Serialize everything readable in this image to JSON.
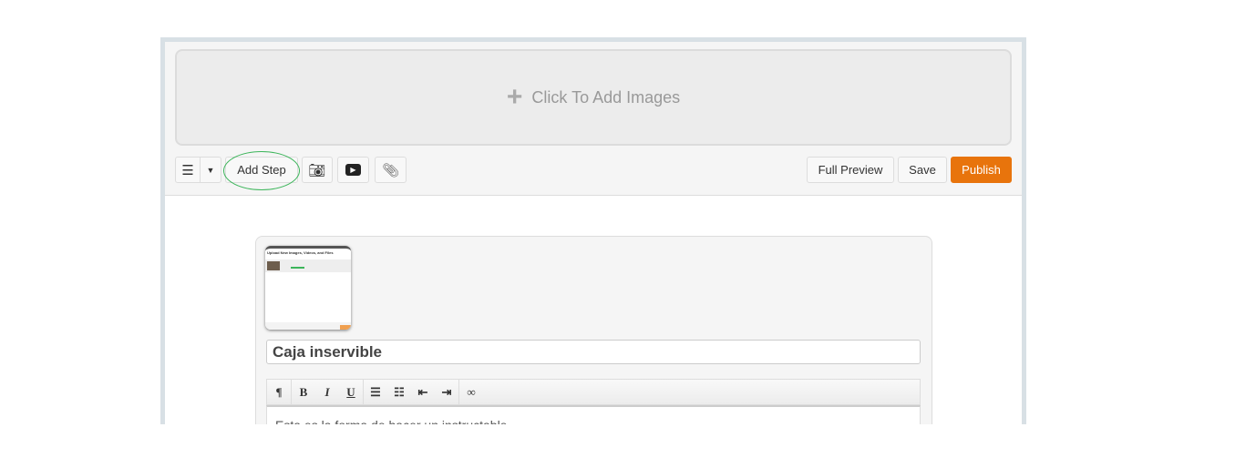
{
  "dropzone": {
    "label": "Click To Add Images",
    "icon": "plus-icon"
  },
  "toolbar": {
    "add_step": "Add Step",
    "full_preview": "Full Preview",
    "save": "Save",
    "publish": "Publish",
    "accent": "#e8740c"
  },
  "step": {
    "thumbnail_title": "Upload New Images, Videos, and Files",
    "title": "Caja inservible",
    "body": "Esta es la forma de hacer un instructable"
  },
  "editor": {
    "paragraph": "¶",
    "bold": "B",
    "italic": "I",
    "underline": "U",
    "bullets": "☰",
    "numbers": "☷",
    "outdent": "⇤",
    "indent": "⇥",
    "link": "∞"
  }
}
